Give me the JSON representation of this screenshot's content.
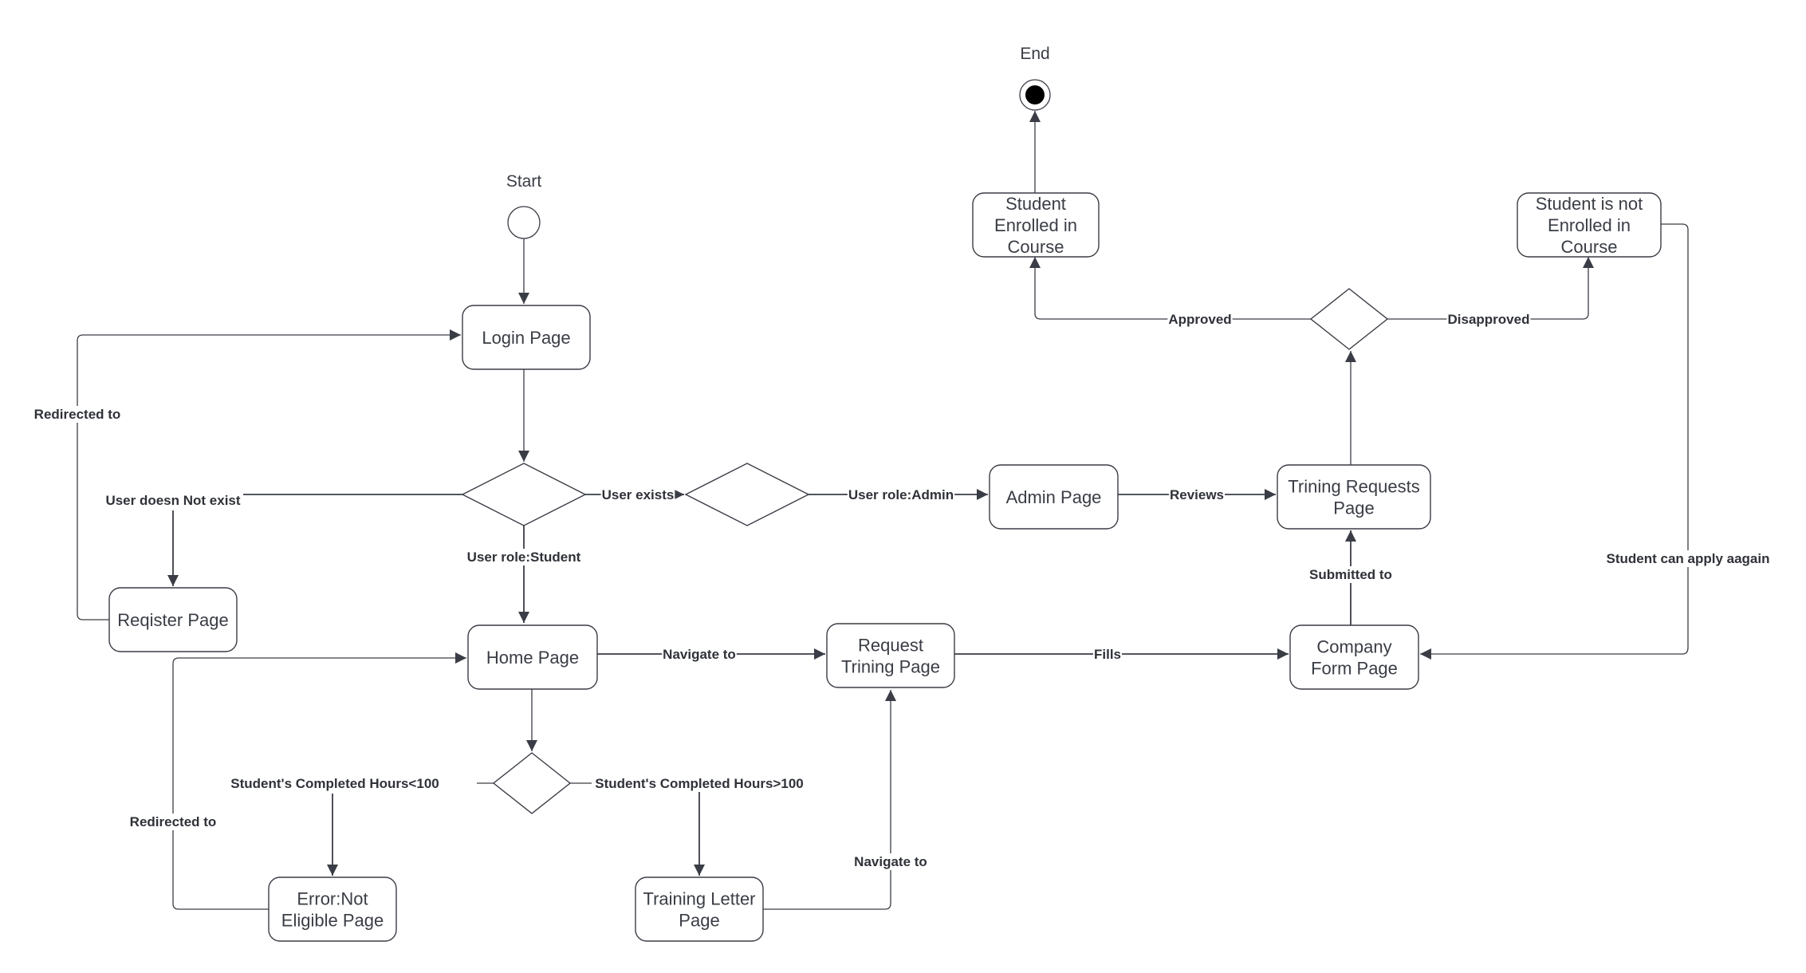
{
  "diagram": {
    "type": "activity-diagram",
    "start": {
      "label": "Start"
    },
    "end": {
      "label": "End"
    },
    "nodes": {
      "login": {
        "lines": [
          "Login Page"
        ]
      },
      "register": {
        "lines": [
          "Reqister Page"
        ]
      },
      "home": {
        "lines": [
          "Home Page"
        ]
      },
      "error": {
        "lines": [
          "Error:Not",
          "Eligible Page"
        ]
      },
      "training_letter": {
        "lines": [
          "Training Letter",
          "Page"
        ]
      },
      "request_training": {
        "lines": [
          "Request",
          "Trining Page"
        ]
      },
      "company_form": {
        "lines": [
          "Company",
          "Form Page"
        ]
      },
      "admin": {
        "lines": [
          "Admin Page"
        ]
      },
      "training_requests": {
        "lines": [
          "Trining Requests",
          "Page"
        ]
      },
      "enrolled": {
        "lines": [
          "Student",
          "Enrolled in",
          "Course"
        ]
      },
      "not_enrolled": {
        "lines": [
          "Student is not",
          "Enrolled in",
          "Course"
        ]
      }
    },
    "edge_labels": {
      "redirected_to_login": "Redirected to",
      "user_not_exist": "User doesn Not exist",
      "user_exists": "User exists",
      "user_role_admin": "User role:Admin",
      "reviews": "Reviews",
      "user_role_student": "User role:Student",
      "navigate_to_request": "Navigate to",
      "fills": "Fills",
      "submitted_to": "Submitted to",
      "approved": "Approved",
      "disapproved": "Disapproved",
      "apply_again": "Student can apply aagain",
      "hours_less": "Student's Completed Hours<100",
      "hours_more": "Student's Completed Hours>100",
      "redirected_to_home": "Redirected to",
      "navigate_to_from_letter": "Navigate to"
    },
    "colors": {
      "stroke": "#3a3d45",
      "text": "#3a3d45",
      "background": "#ffffff"
    }
  }
}
